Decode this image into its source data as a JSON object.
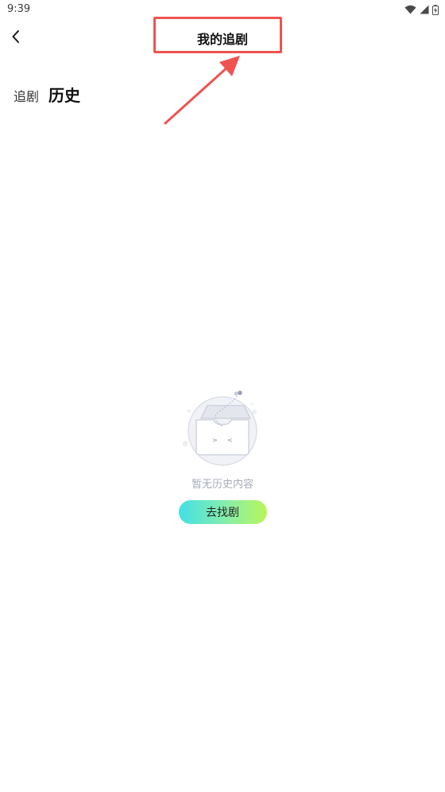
{
  "status_bar": {
    "time": "9:39",
    "icons": [
      "wifi-icon",
      "signal-icon",
      "battery-icon"
    ]
  },
  "header": {
    "title": "我的追剧",
    "back_icon": "chevron-left-icon"
  },
  "tabs": [
    {
      "label": "追剧",
      "active": false
    },
    {
      "label": "历史",
      "active": true
    }
  ],
  "empty_state": {
    "illustration": "empty-inbox-icon",
    "message": "暂无历史内容",
    "action_label": "去找剧"
  },
  "annotation": {
    "color": "#ef5350"
  },
  "colors": {
    "gradient_start": "#43e0e6",
    "gradient_end": "#b8f55a",
    "muted_text": "#a6abb8"
  }
}
